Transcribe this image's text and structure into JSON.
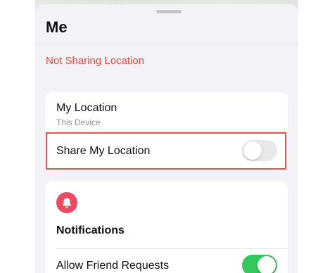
{
  "sheet": {
    "title": "Me"
  },
  "status": {
    "text": "Not Sharing Location",
    "color": "#e5483b"
  },
  "location_card": {
    "title": "My Location",
    "subtitle": "This Device",
    "share_label": "Share My Location",
    "share_enabled": false
  },
  "notifications": {
    "icon": "bell-icon",
    "icon_color": "#ec4a62",
    "title": "Notifications",
    "allow_requests_label": "Allow Friend Requests",
    "allow_requests_enabled": true
  },
  "colors": {
    "toggle_on": "#34c759",
    "toggle_off": "#e9e9eb",
    "highlight": "#e3584c"
  }
}
